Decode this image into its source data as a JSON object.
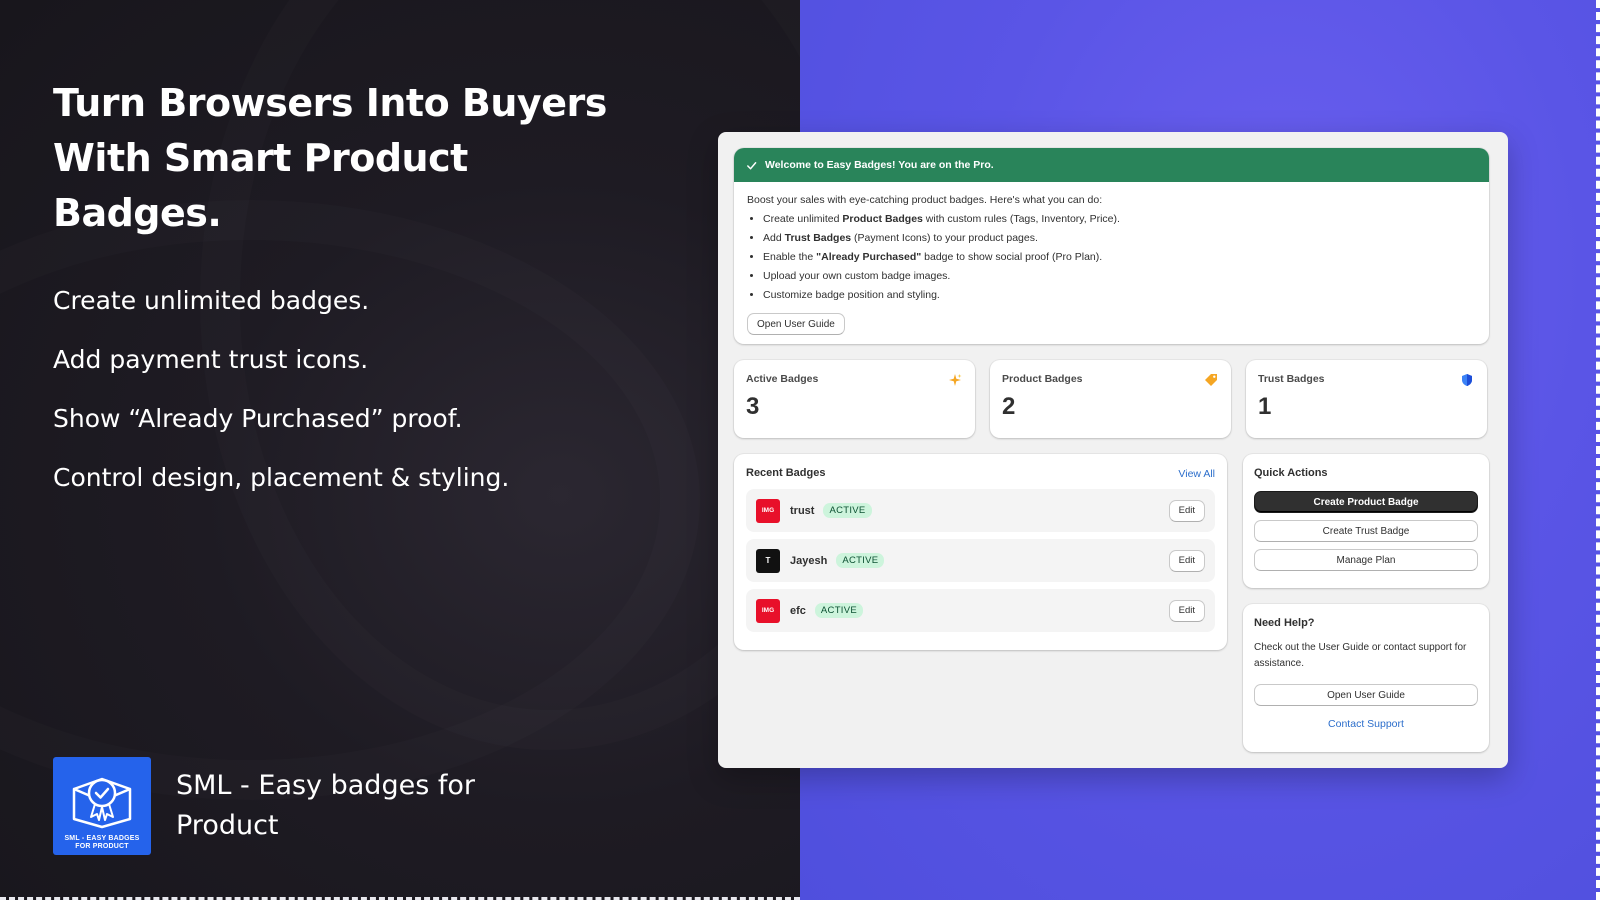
{
  "hero": {
    "headline": "Turn Browsers Into Buyers With Smart Product Badges.",
    "features": [
      "Create unlimited badges.",
      "Add payment trust icons.",
      "Show “Already Purchased” proof.",
      "Control design, placement & styling."
    ],
    "brand_name": "SML - Easy badges for Product",
    "logo_text_line1": "SML - EASY BADGES",
    "logo_text_line2": "FOR PRODUCT",
    "logo_bg": "#2563eb"
  },
  "app": {
    "welcome": {
      "banner": "Welcome to Easy Badges! You are on the Pro.",
      "intro": "Boost your sales with eye-catching product badges. Here's what you can do:",
      "items": [
        {
          "pre": "Create unlimited ",
          "bold": "Product Badges",
          "post": " with custom rules (Tags, Inventory, Price)."
        },
        {
          "pre": "Add ",
          "bold": "Trust Badges",
          "post": " (Payment Icons) to your product pages."
        },
        {
          "pre": "Enable the ",
          "bold": "\"Already Purchased\"",
          "post": " badge to show social proof (Pro Plan)."
        },
        {
          "pre": "Upload your own custom badge images.",
          "bold": "",
          "post": ""
        },
        {
          "pre": "Customize badge position and styling.",
          "bold": "",
          "post": ""
        }
      ],
      "guide_button": "Open User Guide",
      "banner_color": "#29845a"
    },
    "stats": [
      {
        "label": "Active Badges",
        "value": "3",
        "icon": "sparkle-icon"
      },
      {
        "label": "Product Badges",
        "value": "2",
        "icon": "tag-icon"
      },
      {
        "label": "Trust Badges",
        "value": "1",
        "icon": "shield-icon"
      }
    ],
    "recent": {
      "title": "Recent Badges",
      "view_all": "View All",
      "rows": [
        {
          "thumb": "IMG",
          "name": "trust",
          "status": "ACTIVE",
          "edit": "Edit"
        },
        {
          "thumb": "T",
          "name": "Jayesh",
          "status": "ACTIVE",
          "edit": "Edit"
        },
        {
          "thumb": "IMG",
          "name": "efc",
          "status": "ACTIVE",
          "edit": "Edit"
        }
      ]
    },
    "quick_actions": {
      "title": "Quick Actions",
      "create_product": "Create Product Badge",
      "create_trust": "Create Trust Badge",
      "manage_plan": "Manage Plan"
    },
    "help": {
      "title": "Need Help?",
      "text": "Check out the User Guide or contact support for assistance.",
      "guide_button": "Open User Guide",
      "contact": "Contact Support"
    }
  }
}
